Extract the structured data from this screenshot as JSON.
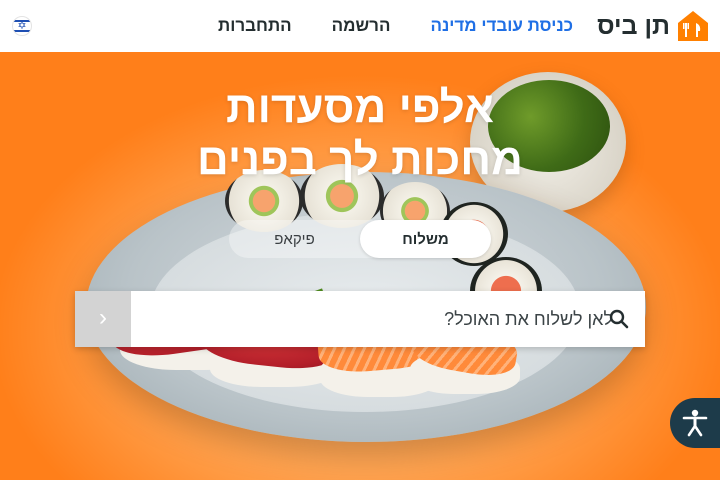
{
  "header": {
    "brand": "תן ביס",
    "nav": {
      "gov_employees": "כניסת עובדי מדינה",
      "register": "הרשמה",
      "login": "התחברות"
    },
    "language_flag": "israel-flag-icon"
  },
  "hero": {
    "headline_line1": "אלפי מסעדות",
    "headline_line2": "מחכות לך בפנים",
    "mode_toggle": {
      "delivery": "משלוח",
      "pickup": "פיקאפ",
      "selected": "delivery"
    },
    "search": {
      "placeholder": "לאן לשלוח את האוכל?",
      "value": "",
      "go_icon": "chevron-right-icon",
      "search_icon": "magnifier-icon"
    }
  },
  "accessibility_button_icon": "accessibility-person-icon",
  "colors": {
    "brand_orange": "#ff8000",
    "nav_accent": "#1f6fe5",
    "text_dark": "#242e30",
    "a11y_bg": "#1d3b4a"
  }
}
